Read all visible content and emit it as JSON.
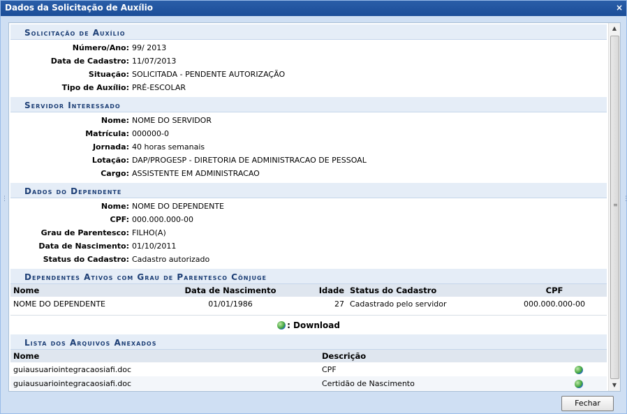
{
  "window": {
    "title": "Dados da Solicitação de Auxílio",
    "close_glyph": "×"
  },
  "solicitacao": {
    "title": "Solicitação de Auxílio",
    "fields": [
      {
        "label": "Número/Ano:",
        "value": "99/ 2013"
      },
      {
        "label": "Data de Cadastro:",
        "value": "11/07/2013"
      },
      {
        "label": "Situação:",
        "value": "SOLICITADA - PENDENTE AUTORIZAÇÃO"
      },
      {
        "label": "Tipo de Auxílio:",
        "value": "PRÉ-ESCOLAR"
      }
    ]
  },
  "servidor": {
    "title": "Servidor Interessado",
    "fields": [
      {
        "label": "Nome:",
        "value": "NOME DO SERVIDOR"
      },
      {
        "label": "Matrícula:",
        "value": "000000-0"
      },
      {
        "label": "Jornada:",
        "value": "40 horas semanais"
      },
      {
        "label": "Lotação:",
        "value": "DAP/PROGESP - DIRETORIA DE ADMINISTRACAO DE PESSOAL"
      },
      {
        "label": "Cargo:",
        "value": "ASSISTENTE EM ADMINISTRACAO"
      }
    ]
  },
  "dependente": {
    "title": "Dados do Dependente",
    "fields": [
      {
        "label": "Nome:",
        "value": "NOME DO DEPENDENTE"
      },
      {
        "label": "CPF:",
        "value": "000.000.000-00"
      },
      {
        "label": "Grau de Parentesco:",
        "value": "FILHO(A)"
      },
      {
        "label": "Data de Nascimento:",
        "value": "01/10/2011"
      },
      {
        "label": "Status do Cadastro:",
        "value": "Cadastro autorizado"
      }
    ]
  },
  "conjuge": {
    "title": "Dependentes Ativos com Grau de Parentesco Cônjuge",
    "columns": [
      "Nome",
      "Data de Nascimento",
      "Idade",
      "Status do Cadastro",
      "CPF"
    ],
    "rows": [
      [
        "NOME DO DEPENDENTE",
        "01/01/1986",
        "27",
        "Cadastrado pelo servidor",
        "000.000.000-00"
      ]
    ],
    "legend": ": Download",
    "legend_icon": "globe-download-icon"
  },
  "arquivos": {
    "title": "Lista dos Arquivos Anexados",
    "columns": [
      "Nome",
      "Descrição"
    ],
    "rows": [
      {
        "nome": "guiausuariointegracaosiafi.doc",
        "descricao": "CPF"
      },
      {
        "nome": "guiausuariointegracaosiafi.doc",
        "descricao": "Certidão de Nascimento"
      }
    ]
  },
  "footer": {
    "close_button": "Fechar"
  },
  "colors": {
    "title_bar": "#1b4d98",
    "section_header": "#e5edf7",
    "section_text": "#1d3f76"
  }
}
